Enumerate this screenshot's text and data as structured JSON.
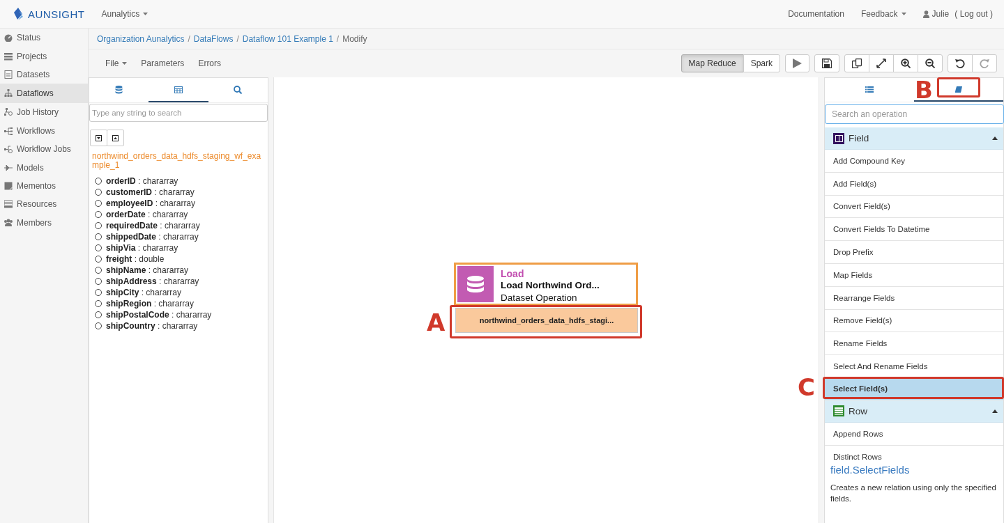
{
  "brand": {
    "name": "AUNSIGHT"
  },
  "topbar": {
    "org_menu": "Aunalytics",
    "links": [
      {
        "label": "Documentation",
        "kind": "link"
      },
      {
        "label": "Feedback",
        "kind": "dropdown"
      }
    ],
    "user": {
      "name": "Julie",
      "logout": "( Log out )"
    }
  },
  "sidebar": {
    "items": [
      {
        "label": "Status",
        "selected": false
      },
      {
        "label": "Projects",
        "selected": false
      },
      {
        "label": "Datasets",
        "selected": false
      },
      {
        "label": "Dataflows",
        "selected": true
      },
      {
        "label": "Job History",
        "selected": false
      },
      {
        "label": "Workflows",
        "selected": false
      },
      {
        "label": "Workflow Jobs",
        "selected": false
      },
      {
        "label": "Models",
        "selected": false
      },
      {
        "label": "Mementos",
        "selected": false
      },
      {
        "label": "Resources",
        "selected": false
      },
      {
        "label": "Members",
        "selected": false
      }
    ]
  },
  "breadcrumb": [
    {
      "label": "Organization Aunalytics",
      "kind": "link",
      "separator": "/"
    },
    {
      "label": "DataFlows",
      "kind": "link",
      "separator": "/"
    },
    {
      "label": "Dataflow 101 Example 1",
      "kind": "link",
      "separator": "/"
    },
    {
      "label": "Modify",
      "kind": "current"
    }
  ],
  "toolbar": {
    "menus": [
      {
        "label": "File",
        "kind": "dropdown"
      },
      {
        "label": "Parameters",
        "kind": "link"
      },
      {
        "label": "Errors",
        "kind": "link"
      }
    ],
    "engines": [
      {
        "label": "Map Reduce",
        "selected": true
      },
      {
        "label": "Spark",
        "selected": false
      }
    ],
    "tool_buttons": [
      {
        "kind": "run",
        "disabled": false
      },
      {
        "kind": "save",
        "disabled": false
      },
      {
        "kind": "copy",
        "disabled": false
      },
      {
        "kind": "fit",
        "disabled": false
      },
      {
        "kind": "zoom_in",
        "disabled": false
      },
      {
        "kind": "zoom_out",
        "disabled": false
      },
      {
        "kind": "undo",
        "disabled": false
      },
      {
        "kind": "redo",
        "disabled": true
      }
    ]
  },
  "schema_panel": {
    "tabs": [
      {
        "kind": "database",
        "selected": false
      },
      {
        "kind": "table",
        "selected": true
      },
      {
        "kind": "search",
        "selected": false
      }
    ],
    "search": {
      "placeholder": "Type any string to search"
    },
    "dataset": "northwind_orders_data_hdfs_staging_wf_example_1",
    "fields": [
      {
        "name": "orderID",
        "type": ": chararray",
        "selected": false
      },
      {
        "name": "customerID",
        "type": ": chararray",
        "selected": false
      },
      {
        "name": "employeeID",
        "type": ": chararray",
        "selected": false
      },
      {
        "name": "orderDate",
        "type": ": chararray",
        "selected": false
      },
      {
        "name": "requiredDate",
        "type": ": chararray",
        "selected": false
      },
      {
        "name": "shippedDate",
        "type": ": chararray",
        "selected": false
      },
      {
        "name": "shipVia",
        "type": ": chararray",
        "selected": false
      },
      {
        "name": "freight",
        "type": ": double",
        "selected": false
      },
      {
        "name": "shipName",
        "type": ": chararray",
        "selected": false
      },
      {
        "name": "shipAddress",
        "type": ": chararray",
        "selected": false
      },
      {
        "name": "shipCity",
        "type": ": chararray",
        "selected": false
      },
      {
        "name": "shipRegion",
        "type": ": chararray",
        "selected": false
      },
      {
        "name": "shipPostalCode",
        "type": ": chararray",
        "selected": false
      },
      {
        "name": "shipCountry",
        "type": ": chararray",
        "selected": false
      }
    ]
  },
  "canvas": {
    "node": {
      "category": "Load",
      "title": "Load Northwind Ord...",
      "subtitle": "Dataset Operation",
      "output": "northwind_orders_data_hdfs_stagi..."
    }
  },
  "operations_panel": {
    "tabs": [
      {
        "kind": "list",
        "selected": false
      },
      {
        "kind": "book",
        "selected": true
      }
    ],
    "search": {
      "placeholder": "Search an operation"
    },
    "groups": [
      {
        "label": "Field",
        "kind": "field",
        "expanded": true,
        "items": [
          {
            "label": "Add Compound Key",
            "selected": false
          },
          {
            "label": "Add Field(s)",
            "selected": false
          },
          {
            "label": "Convert Field(s)",
            "selected": false
          },
          {
            "label": "Convert Fields To Datetime",
            "selected": false
          },
          {
            "label": "Drop Prefix",
            "selected": false
          },
          {
            "label": "Map Fields",
            "selected": false
          },
          {
            "label": "Rearrange Fields",
            "selected": false
          },
          {
            "label": "Remove Field(s)",
            "selected": false
          },
          {
            "label": "Rename Fields",
            "selected": false
          },
          {
            "label": "Select And Rename Fields",
            "selected": false
          },
          {
            "label": "Select Field(s)",
            "selected": true
          }
        ]
      },
      {
        "label": "Row",
        "kind": "row",
        "expanded": true,
        "items": [
          {
            "label": "Append Rows",
            "selected": false
          },
          {
            "label": "Distinct Rows",
            "selected": false
          }
        ]
      }
    ],
    "description": {
      "title": "field.SelectFields",
      "text": "Creates a new relation using only the specified fields."
    }
  },
  "annotations": [
    {
      "label": "A"
    },
    {
      "label": "B"
    },
    {
      "label": "C"
    }
  ]
}
